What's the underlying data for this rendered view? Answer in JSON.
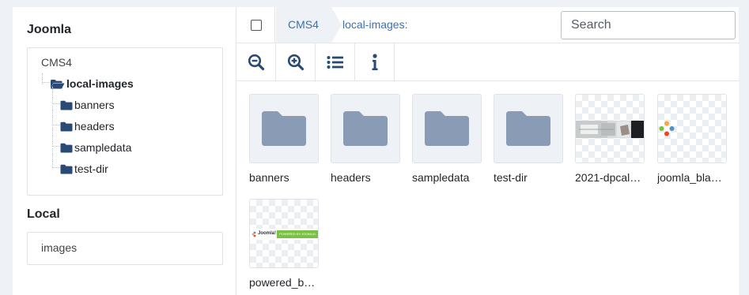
{
  "sidebar": {
    "joomla_title": "Joomla",
    "tree": {
      "root": "CMS4",
      "current": "local-images",
      "children": [
        "banners",
        "headers",
        "sampledata",
        "test-dir"
      ]
    },
    "local_title": "Local",
    "local_items": [
      "images"
    ]
  },
  "breadcrumb": {
    "root": "CMS4",
    "current": "local-images:"
  },
  "search": {
    "placeholder": "Search"
  },
  "toolbar": {
    "zoom_out_icon": "magnifier-minus-icon",
    "zoom_in_icon": "magnifier-plus-icon",
    "list_view_icon": "list-icon",
    "info_icon": "info-icon"
  },
  "items": [
    {
      "type": "folder",
      "label": "banners"
    },
    {
      "type": "folder",
      "label": "headers"
    },
    {
      "type": "folder",
      "label": "sampledata"
    },
    {
      "type": "folder",
      "label": "test-dir"
    },
    {
      "type": "image",
      "label": "2021-dpcal…"
    },
    {
      "type": "image",
      "label": "joomla_bla…"
    },
    {
      "type": "image",
      "label": "powered_b…",
      "image_text": [
        "Joomla!",
        "POWERED BY JOOMLA!"
      ]
    }
  ],
  "colors": {
    "folder": "#8a9bb5",
    "folder_nav": "#2a4a75",
    "link": "#3c71b0",
    "joomla_green": "#7ac143"
  }
}
